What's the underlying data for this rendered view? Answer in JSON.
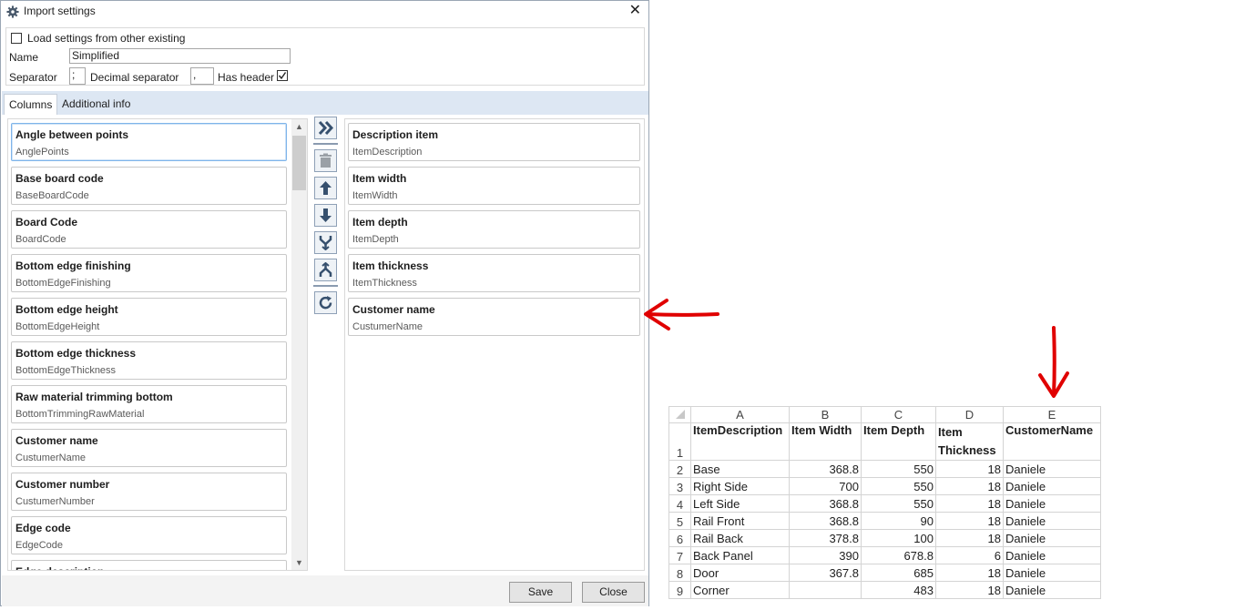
{
  "dialog": {
    "title": "Import settings",
    "close_glyph": "✕",
    "load_label": "Load settings from other existing",
    "load_checked": false,
    "name_label": "Name",
    "name_value": "Simplified",
    "separator_label": "Separator",
    "separator_value": ";",
    "decimal_label": "Decimal separator",
    "decimal_value": ",",
    "header_label": "Has header",
    "header_checked": true,
    "tabs": [
      "Columns",
      "Additional info"
    ],
    "available_columns": [
      {
        "title": "Angle between points",
        "field": "AnglePoints"
      },
      {
        "title": "Base board code",
        "field": "BaseBoardCode"
      },
      {
        "title": "Board Code",
        "field": "BoardCode"
      },
      {
        "title": "Bottom edge finishing",
        "field": "BottomEdgeFinishing"
      },
      {
        "title": "Bottom edge height",
        "field": "BottomEdgeHeight"
      },
      {
        "title": "Bottom edge thickness",
        "field": "BottomEdgeThickness"
      },
      {
        "title": "Raw material trimming bottom",
        "field": "BottomTrimmingRawMaterial"
      },
      {
        "title": "Customer name",
        "field": "CustumerName"
      },
      {
        "title": "Customer number",
        "field": "CustumerNumber"
      },
      {
        "title": "Edge code",
        "field": "EdgeCode"
      },
      {
        "title": "Edge description",
        "field": ""
      }
    ],
    "selected_columns": [
      {
        "title": "Description item",
        "field": "ItemDescription"
      },
      {
        "title": "Item width",
        "field": "ItemWidth"
      },
      {
        "title": "Item depth",
        "field": "ItemDepth"
      },
      {
        "title": "Item thickness",
        "field": "ItemThickness"
      },
      {
        "title": "Customer name",
        "field": "CustumerName"
      }
    ],
    "tools": [
      "add-all-icon",
      "delete-icon",
      "move-up-icon",
      "move-down-icon",
      "merge-icon",
      "split-icon",
      "refresh-icon"
    ],
    "save_label": "Save",
    "close_label": "Close"
  },
  "sheet": {
    "col_letters": [
      "A",
      "B",
      "C",
      "D",
      "E"
    ],
    "headers": [
      "ItemDescription",
      "Item Width",
      "Item Depth",
      "Item Thickness",
      "CustomerName"
    ],
    "rows": [
      {
        "n": "2",
        "cells": [
          "Base",
          "368.8",
          "550",
          "18",
          "Daniele"
        ]
      },
      {
        "n": "3",
        "cells": [
          "Right Side",
          "700",
          "550",
          "18",
          "Daniele"
        ]
      },
      {
        "n": "4",
        "cells": [
          "Left Side",
          "368.8",
          "550",
          "18",
          "Daniele"
        ]
      },
      {
        "n": "5",
        "cells": [
          "Rail Front",
          "368.8",
          "90",
          "18",
          "Daniele"
        ]
      },
      {
        "n": "6",
        "cells": [
          "Rail Back",
          "378.8",
          "100",
          "18",
          "Daniele"
        ]
      },
      {
        "n": "7",
        "cells": [
          "Back Panel",
          "390",
          "678.8",
          "6",
          "Daniele"
        ]
      },
      {
        "n": "8",
        "cells": [
          "Door",
          "367.8",
          "685",
          "18",
          "Daniele"
        ]
      },
      {
        "n": "9",
        "cells": [
          "Corner",
          "",
          "483",
          "18",
          "Daniele"
        ]
      }
    ]
  },
  "colors": {
    "accent": "#4a6484",
    "arrow": "#e00000",
    "tab_strip": "#dde7f3"
  }
}
